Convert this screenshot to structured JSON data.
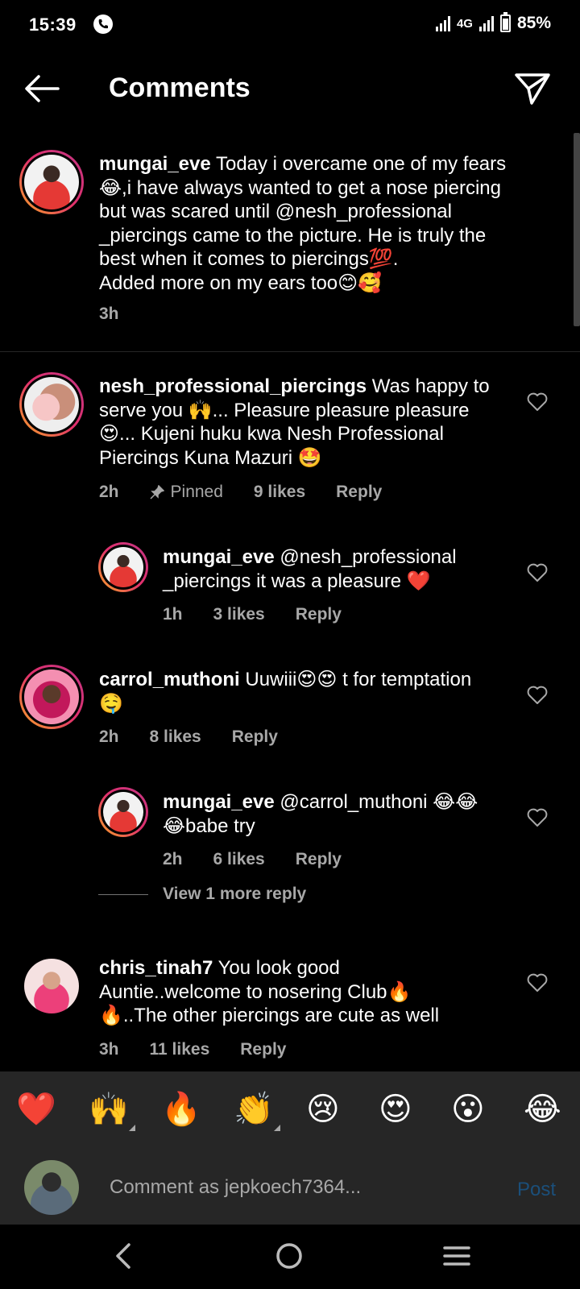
{
  "status_bar": {
    "time": "15:39",
    "network": "4G",
    "battery": "85%",
    "battery_level": 0.85
  },
  "header": {
    "title": "Comments",
    "back_icon": "arrow-left-icon",
    "share_icon": "paper-plane-icon"
  },
  "caption": {
    "username": "mungai_eve",
    "lines": [
      "Today i overcame one of my fears",
      "😂,i have always wanted to get a nose piercing",
      "but was scared until @nesh_professional",
      "_piercings came to the picture. He is truly the",
      "best when it comes to piercings💯.",
      "Added more on my ears too😊🥰"
    ],
    "time": "3h"
  },
  "comments": [
    {
      "username": "nesh_professional_piercings",
      "lines": [
        "Was happy to",
        "serve you 🙌... Pleasure pleasure pleasure",
        "😍... Kujeni huku kwa Nesh Professional",
        "Piercings Kuna Mazuri 🤩"
      ],
      "time": "2h",
      "pinned": "Pinned",
      "likes": "9 likes",
      "reply": "Reply"
    },
    {
      "username": "mungai_eve",
      "lines": [
        "@nesh_professional",
        "_piercings it was a pleasure ❤️"
      ],
      "time": "1h",
      "likes": "3 likes",
      "reply": "Reply"
    },
    {
      "username": "carrol_muthoni",
      "lines": [
        "Uuwiii😍😍 t for temptation",
        "🤤"
      ],
      "time": "2h",
      "likes": "8 likes",
      "reply": "Reply"
    },
    {
      "username": "mungai_eve",
      "lines": [
        "@carrol_muthoni 😂😂",
        "😂babe try"
      ],
      "time": "2h",
      "likes": "6 likes",
      "reply": "Reply"
    },
    {
      "username": "chris_tinah7",
      "lines": [
        "You look good",
        "Auntie..welcome to nosering Club🔥",
        "🔥..The other piercings are cute as well"
      ],
      "time": "3h",
      "likes": "11 likes",
      "reply": "Reply"
    }
  ],
  "view_more_replies": "View 1 more reply",
  "emoji_bar": [
    "❤️",
    "🙌",
    "🔥",
    "👏",
    "😢",
    "😍",
    "😮",
    "😂"
  ],
  "composer": {
    "placeholder": "Comment as jepkoech7364...",
    "post_label": "Post"
  },
  "colors": {
    "background": "#000000",
    "secondary_text": "#a8a8a8",
    "bar_background": "#262626",
    "post_disabled": "#1b4f7a"
  }
}
